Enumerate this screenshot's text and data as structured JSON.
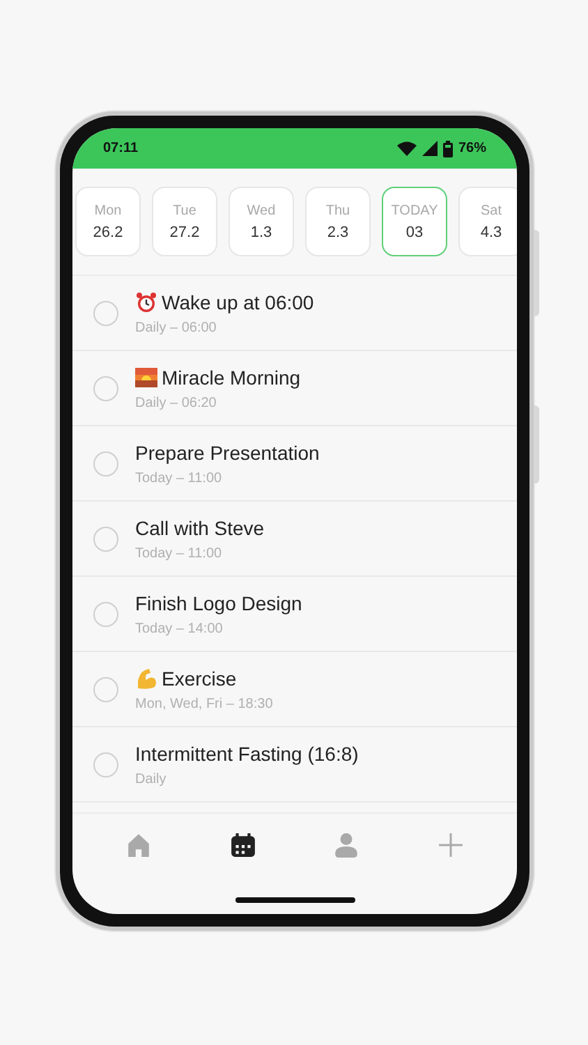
{
  "status_bar": {
    "time": "07:11",
    "battery": "76%"
  },
  "days": [
    {
      "weekday": "Mon",
      "date": "26.2",
      "selected": false
    },
    {
      "weekday": "Tue",
      "date": "27.2",
      "selected": false
    },
    {
      "weekday": "Wed",
      "date": "1.3",
      "selected": false
    },
    {
      "weekday": "Thu",
      "date": "2.3",
      "selected": false
    },
    {
      "weekday": "TODAY",
      "date": "03",
      "selected": true
    },
    {
      "weekday": "Sat",
      "date": "4.3",
      "selected": false
    }
  ],
  "tasks": [
    {
      "title": "Wake up at 06:00",
      "schedule": "Daily – 06:00",
      "checked": false,
      "kind": "alarm"
    },
    {
      "title": "Miracle Morning",
      "schedule": "Daily – 06:20",
      "checked": false,
      "kind": "sunrise"
    },
    {
      "title": "Prepare Presentation",
      "schedule": "Today – 11:00",
      "checked": false,
      "kind": "plain"
    },
    {
      "title": "Call with Steve",
      "schedule": "Today – 11:00",
      "checked": false,
      "kind": "plain"
    },
    {
      "title": "Finish Logo Design",
      "schedule": "Today – 14:00",
      "checked": false,
      "kind": "plain"
    },
    {
      "title": "Exercise",
      "schedule": "Mon, Wed, Fri – 18:30",
      "checked": false,
      "kind": "arm"
    },
    {
      "title": "Intermittent Fasting (16:8)",
      "schedule": "Daily",
      "checked": false,
      "kind": "plain"
    }
  ],
  "nav": [
    {
      "kind": "home",
      "selected": false
    },
    {
      "kind": "calendar",
      "selected": true
    },
    {
      "kind": "profile",
      "selected": false
    },
    {
      "kind": "add",
      "selected": false
    }
  ]
}
